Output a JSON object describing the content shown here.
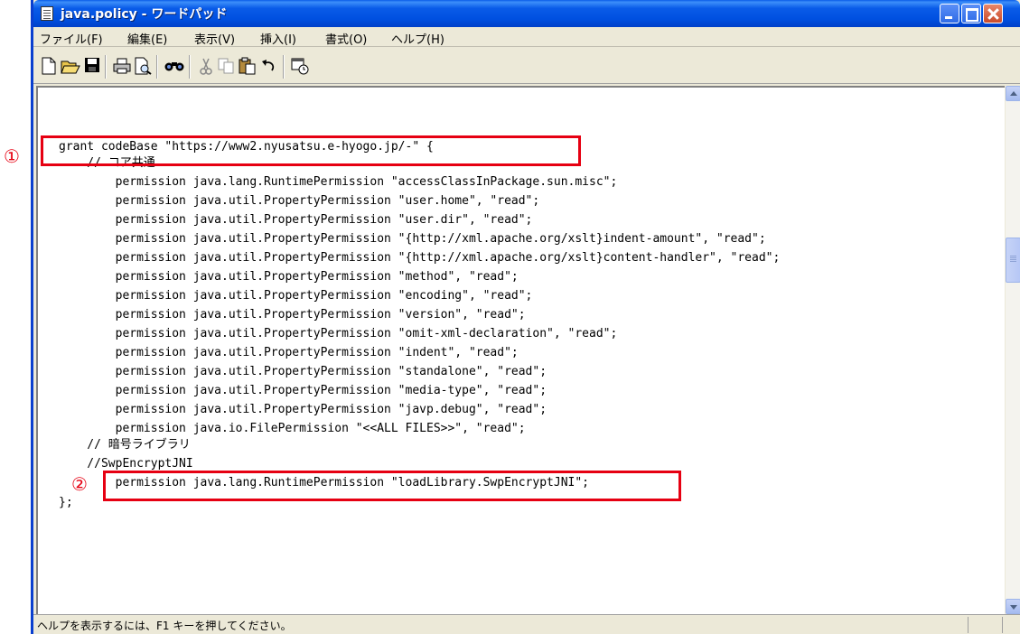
{
  "window": {
    "title": "java.policy - ワードパッド"
  },
  "menubar": {
    "items": [
      "ファイル(F)",
      "編集(E)",
      "表示(V)",
      "挿入(I)",
      "書式(O)",
      "ヘルプ(H)"
    ]
  },
  "toolbar": {
    "icons": [
      "new-icon",
      "open-icon",
      "save-icon",
      "print-icon",
      "print-preview-icon",
      "find-icon",
      "cut-icon",
      "copy-icon",
      "paste-icon",
      "undo-icon",
      "insert-datetime-icon"
    ]
  },
  "document": {
    "lines": [
      "grant codeBase \"https://www2.nyusatsu.e-hyogo.jp/-\" {",
      "    // コア共通",
      "        permission java.lang.RuntimePermission \"accessClassInPackage.sun.misc\";",
      "        permission java.util.PropertyPermission \"user.home\", \"read\";",
      "        permission java.util.PropertyPermission \"user.dir\", \"read\";",
      "        permission java.util.PropertyPermission \"{http://xml.apache.org/xslt}indent-amount\", \"read\";",
      "        permission java.util.PropertyPermission \"{http://xml.apache.org/xslt}content-handler\", \"read\";",
      "        permission java.util.PropertyPermission \"method\", \"read\";",
      "        permission java.util.PropertyPermission \"encoding\", \"read\";",
      "        permission java.util.PropertyPermission \"version\", \"read\";",
      "        permission java.util.PropertyPermission \"omit-xml-declaration\", \"read\";",
      "        permission java.util.PropertyPermission \"indent\", \"read\";",
      "        permission java.util.PropertyPermission \"standalone\", \"read\";",
      "        permission java.util.PropertyPermission \"media-type\", \"read\";",
      "        permission java.util.PropertyPermission \"javp.debug\", \"read\";",
      "        permission java.io.FilePermission \"<<ALL FILES>>\", \"read\";",
      "    // 暗号ライブラリ",
      "    //SwpEncryptJNI",
      "        permission java.lang.RuntimePermission \"loadLibrary.SwpEncryptJNI\";",
      "};"
    ]
  },
  "annotations": {
    "marker1": "①",
    "marker2": "②"
  },
  "statusbar": {
    "text": "ヘルプを表示するには、F1 キーを押してください。"
  },
  "colors": {
    "highlight": "#e60012",
    "titlebar": "#0a5ce8"
  }
}
